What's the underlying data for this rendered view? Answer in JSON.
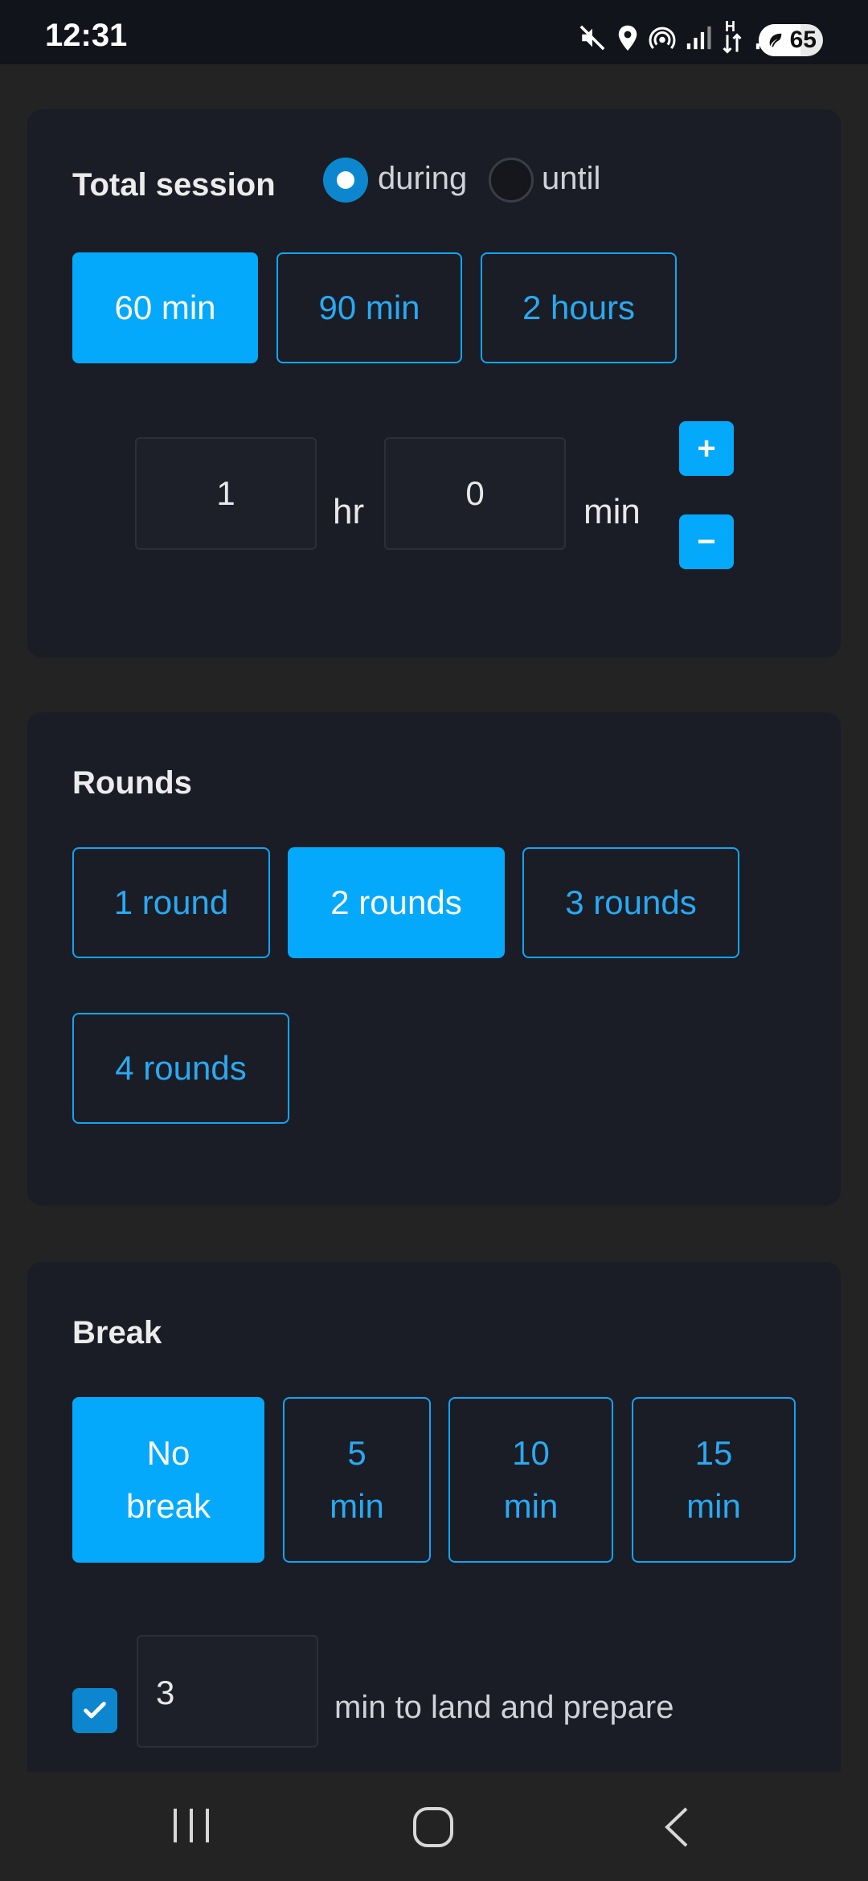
{
  "status_bar": {
    "time": "12:31",
    "battery": "65",
    "icons": [
      "mute-icon",
      "location-icon",
      "hotspot-icon",
      "signal-icon",
      "data-h-icon",
      "signal-icon-2",
      "battery-icon"
    ]
  },
  "session": {
    "title": "Total session",
    "radio_during": "during",
    "radio_until": "until",
    "selected_mode": "during",
    "presets": [
      "60 min",
      "90 min",
      "2 hours"
    ],
    "selected_preset": "60 min",
    "hours_value": "1",
    "hours_unit": "hr",
    "minutes_value": "0",
    "minutes_unit": "min",
    "plus_label": "+",
    "minus_label": "−"
  },
  "rounds": {
    "title": "Rounds",
    "options": [
      "1 round",
      "2 rounds",
      "3 rounds",
      "4 rounds"
    ],
    "selected": "2 rounds"
  },
  "break": {
    "title": "Break",
    "options": [
      "No\nbreak",
      "5\nmin",
      "10\nmin",
      "15\nmin"
    ],
    "opt0_line1": "No",
    "opt0_line2": "break",
    "opt1_line1": "5",
    "opt1_line2": "min",
    "opt2_line1": "10",
    "opt2_line2": "min",
    "opt3_line1": "15",
    "opt3_line2": "min",
    "selected": "No break"
  },
  "prepare": {
    "checked": true,
    "value": "3",
    "label": "min to land and prepare"
  },
  "colors": {
    "accent": "#04a9fb",
    "card_bg": "#1a1d25",
    "page_bg": "#232323"
  }
}
